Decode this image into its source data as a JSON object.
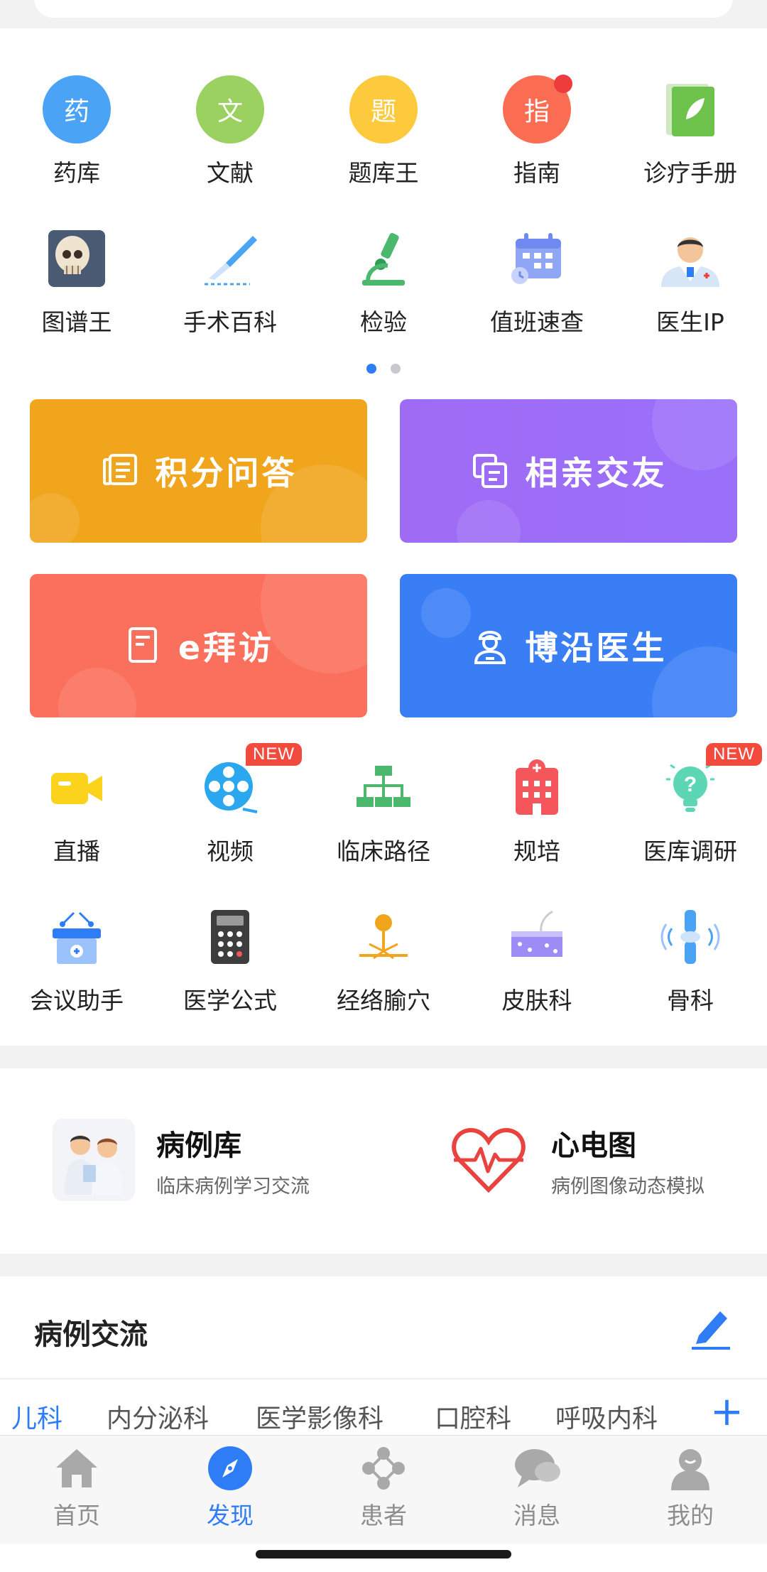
{
  "grid1": [
    {
      "label": "药库",
      "glyph": "药",
      "icon": "drug-library-icon",
      "color": "#4aa3f5"
    },
    {
      "label": "文献",
      "glyph": "文",
      "icon": "literature-icon",
      "color": "#9ad160"
    },
    {
      "label": "题库王",
      "glyph": "题",
      "icon": "question-bank-icon",
      "color": "#fdc93d"
    },
    {
      "label": "指南",
      "glyph": "指",
      "icon": "guide-icon",
      "color": "#fb6d52",
      "red_dot": true
    },
    {
      "label": "诊疗手册",
      "icon": "handbook-icon",
      "color": "#6cc24a"
    }
  ],
  "grid2": [
    {
      "label": "图谱王",
      "icon": "skull-atlas-icon"
    },
    {
      "label": "手术百科",
      "icon": "scalpel-icon"
    },
    {
      "label": "检验",
      "icon": "microscope-icon"
    },
    {
      "label": "值班速查",
      "icon": "calendar-icon"
    },
    {
      "label": "医生IP",
      "icon": "doctor-icon"
    }
  ],
  "banners": [
    {
      "label": "积分问答",
      "icon": "document-icon",
      "color": "#f1a51c"
    },
    {
      "label": "相亲交友",
      "icon": "chat-icon",
      "color": "#9d6cf7"
    },
    {
      "label": "e拜访",
      "icon": "visit-icon",
      "color": "#fb705c"
    },
    {
      "label": "博沿医生",
      "icon": "doctor-outline-icon",
      "color": "#3a7ef6"
    }
  ],
  "grid3": [
    {
      "label": "直播",
      "icon": "video-camera-icon"
    },
    {
      "label": "视频",
      "icon": "film-reel-icon",
      "badge": "NEW"
    },
    {
      "label": "临床路径",
      "icon": "flowchart-icon"
    },
    {
      "label": "规培",
      "icon": "hospital-icon"
    },
    {
      "label": "医库调研",
      "icon": "lightbulb-question-icon",
      "badge": "NEW"
    }
  ],
  "grid4": [
    {
      "label": "会议助手",
      "icon": "meeting-podium-icon"
    },
    {
      "label": "医学公式",
      "icon": "calculator-icon"
    },
    {
      "label": "经络腧穴",
      "icon": "acupoint-icon"
    },
    {
      "label": "皮肤科",
      "icon": "skin-layer-icon"
    },
    {
      "label": "骨科",
      "icon": "bone-joint-icon"
    }
  ],
  "featured": [
    {
      "title": "病例库",
      "subtitle": "临床病例学习交流",
      "icon": "doctors-icon"
    },
    {
      "title": "心电图",
      "subtitle": "病例图像动态模拟",
      "icon": "heart-ecg-icon"
    }
  ],
  "section": {
    "title": "病例交流"
  },
  "tabs": [
    "儿科",
    "内分泌科",
    "医学影像科",
    "口腔科",
    "呼吸内科"
  ],
  "tabs_plus": "+",
  "bottom_nav": [
    {
      "label": "首页",
      "icon": "home-icon"
    },
    {
      "label": "发现",
      "icon": "compass-icon",
      "active": true
    },
    {
      "label": "患者",
      "icon": "network-icon"
    },
    {
      "label": "消息",
      "icon": "message-icon"
    },
    {
      "label": "我的",
      "icon": "profile-icon"
    }
  ],
  "colors": {
    "accent": "#2e7cf6",
    "badge": "#f24a3c"
  }
}
